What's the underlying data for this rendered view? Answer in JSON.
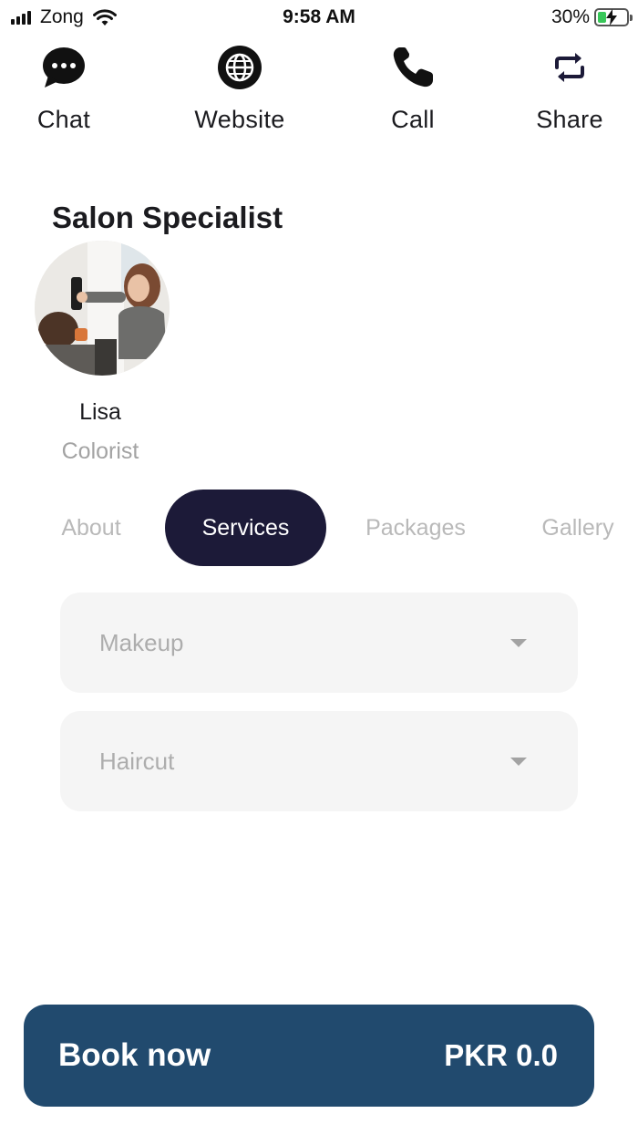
{
  "status_bar": {
    "carrier": "Zong",
    "time": "9:58 AM",
    "battery_percent": "30%",
    "battery_level": 0.3
  },
  "actions": [
    {
      "label": "Chat",
      "icon": "chat-bubble-icon"
    },
    {
      "label": "Website",
      "icon": "globe-icon"
    },
    {
      "label": "Call",
      "icon": "phone-icon"
    },
    {
      "label": "Share",
      "icon": "share-repeat-icon"
    }
  ],
  "section_title": "Salon Specialist",
  "specialist": {
    "name": "Lisa",
    "role": "Colorist"
  },
  "tabs": [
    {
      "label": "About",
      "active": false
    },
    {
      "label": "Services",
      "active": true
    },
    {
      "label": "Packages",
      "active": false
    },
    {
      "label": "Gallery",
      "active": false
    }
  ],
  "services": [
    {
      "label": "Makeup"
    },
    {
      "label": "Haircut"
    }
  ],
  "booking": {
    "button_label": "Book now",
    "price": "PKR 0.0"
  },
  "colors": {
    "active_tab": "#1c1a38",
    "book_bar": "#214a6e",
    "battery_fill": "#38c759"
  }
}
